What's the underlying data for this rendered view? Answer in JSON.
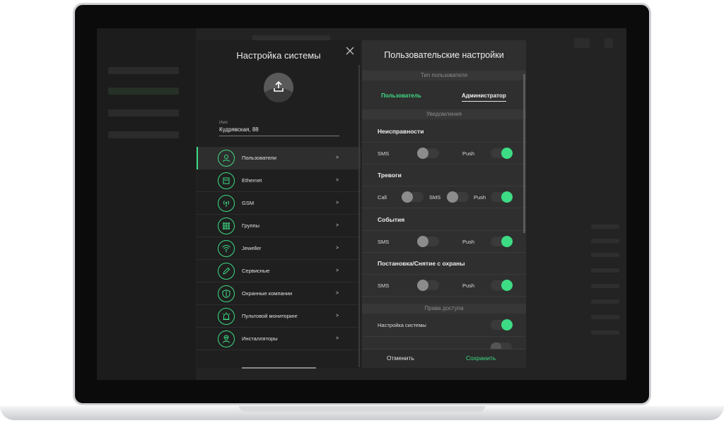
{
  "colors": {
    "accent": "#3ddc84",
    "panel_dark": "#1f1f1f",
    "panel_light": "#2f2f2f"
  },
  "left_panel": {
    "title": "Настройка системы",
    "name_label": "Имя",
    "name_value": "Кудрявская, 88",
    "menu": [
      {
        "label": "Пользователи",
        "icon": "user-icon",
        "arrow": ">"
      },
      {
        "label": "Ethernet",
        "icon": "ethernet-icon",
        "arrow": ">"
      },
      {
        "label": "GSM",
        "icon": "signal-icon",
        "arrow": ">"
      },
      {
        "label": "Группы",
        "icon": "grid-icon",
        "arrow": ">"
      },
      {
        "label": "Jeweller",
        "icon": "wifi-icon",
        "arrow": ">"
      },
      {
        "label": "Сервисные",
        "icon": "pencil-icon",
        "arrow": ">"
      },
      {
        "label": "Охранные компании",
        "icon": "shield-icon",
        "arrow": ">"
      },
      {
        "label": "Пультовой мониторинг",
        "icon": "alarm-icon",
        "arrow": ">"
      },
      {
        "label": "Инсталляторы",
        "icon": "installer-icon",
        "arrow": ">"
      }
    ]
  },
  "right_panel": {
    "title": "Пользовательские настройки",
    "user_type_header": "Тип пользователя",
    "tabs": {
      "user": "Пользователь",
      "admin": "Администратор"
    },
    "notifications_header": "Уведомления",
    "groups": {
      "faults": {
        "title": "Неисправности",
        "sms": "SMS",
        "push": "Push"
      },
      "alarms": {
        "title": "Тревоги",
        "call": "Call",
        "sms": "SMS",
        "push": "Push"
      },
      "events": {
        "title": "События",
        "sms": "SMS",
        "push": "Push"
      },
      "arming": {
        "title": "Постановка/Снятие с охраны",
        "sms": "SMS",
        "push": "Push"
      }
    },
    "access_header": "Права доступа",
    "access": {
      "system_settings": "Настройка системы"
    },
    "footer": {
      "cancel": "Отменить",
      "save": "Сохранить"
    }
  }
}
